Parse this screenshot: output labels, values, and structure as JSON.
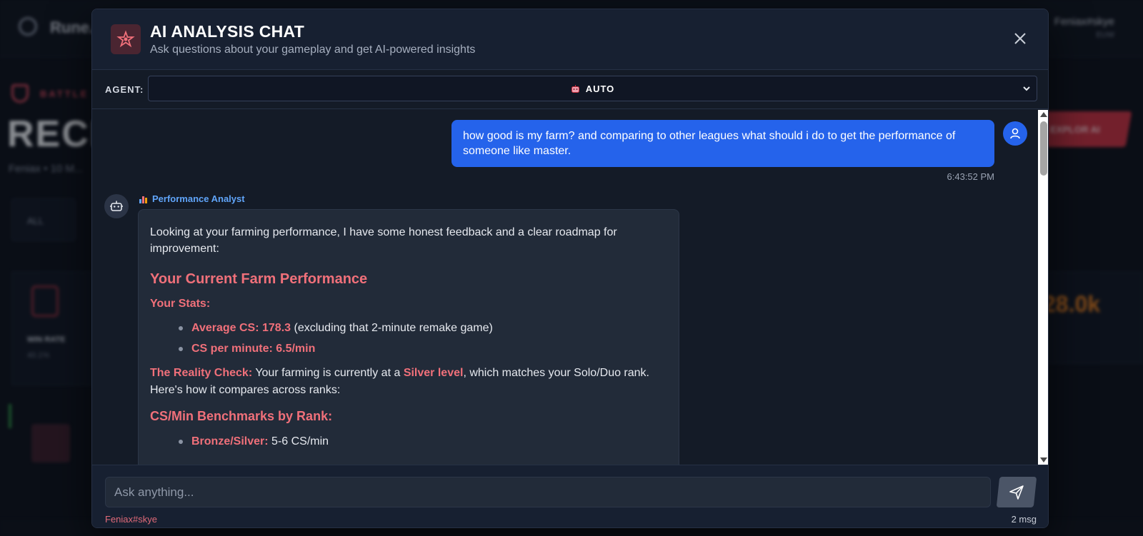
{
  "background": {
    "brand": "Rune...",
    "user_name": "Feniax#skye",
    "user_sub": "EUW",
    "section": "BATTLE",
    "title": "RECE",
    "subline": "Feniax • 10 M...",
    "button": "EXPLOR AI",
    "tab": "ALL",
    "card_label": "WIN RATE",
    "card_sub": "40.1%",
    "stat": "28.0k"
  },
  "modal": {
    "title": "AI ANALYSIS CHAT",
    "subtitle": "Ask questions about your gameplay and get AI-powered insights",
    "close_icon": "close-icon",
    "header_icon": "star-emblem-icon",
    "accent_color": "#f0707a",
    "user_bubble_color": "#2563eb"
  },
  "agent": {
    "label": "AGENT:",
    "selected": "AUTO",
    "icon": "robot-icon"
  },
  "messages": [
    {
      "role": "user",
      "text": "how good is my farm? and comparing to other leagues what should i do to get the performance of someone like master.",
      "time": "6:43:52 PM"
    },
    {
      "role": "assistant",
      "agent_name": "Performance Analyst",
      "intro": "Looking at your farming performance, I have some honest feedback and a clear roadmap for improvement:",
      "heading": "Your Current Farm Performance",
      "stats_heading": "Your Stats:",
      "stats": [
        {
          "label": "Average CS: 178.3",
          "rest": " (excluding that 2-minute remake game)"
        },
        {
          "label": "CS per minute: 6.5/min",
          "rest": ""
        }
      ],
      "reality_label": "The Reality Check:",
      "reality_pre": " Your farming is currently at a ",
      "reality_highlight": "Silver level",
      "reality_post": ", which matches your Solo/Duo rank. Here's how it compares across ranks:",
      "benchmarks_heading": "CS/Min Benchmarks by Rank:",
      "benchmarks": [
        {
          "label": "Bronze/Silver:",
          "rest": " 5-6 CS/min"
        }
      ]
    }
  ],
  "composer": {
    "placeholder": "Ask anything...",
    "value": "",
    "send_icon": "send-icon"
  },
  "footer": {
    "user": "Feniax#skye",
    "count": "2 msg"
  }
}
